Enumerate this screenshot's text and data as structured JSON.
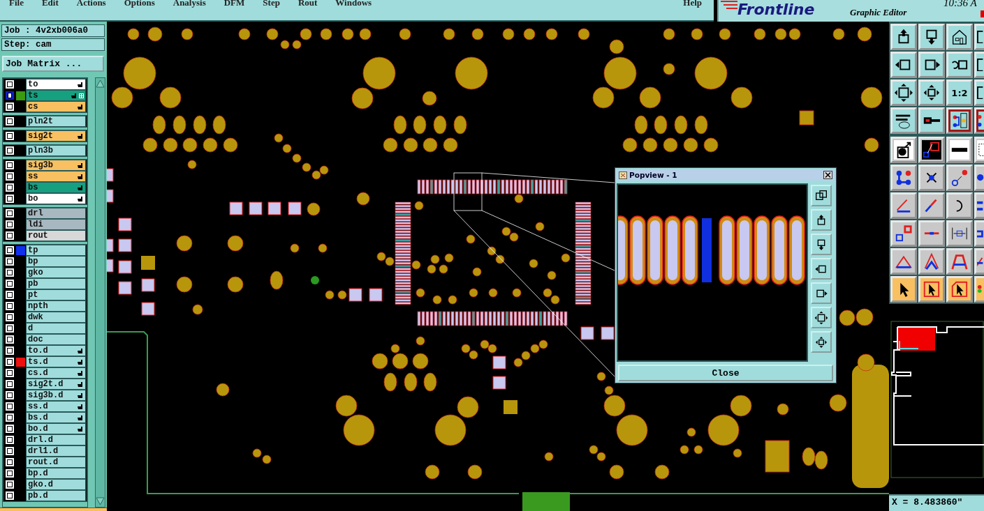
{
  "menu": [
    {
      "label": "File"
    },
    {
      "label": "Edit"
    },
    {
      "label": "Actions"
    },
    {
      "label": "Options"
    },
    {
      "label": "Analysis"
    },
    {
      "label": "DFM"
    },
    {
      "label": "Step"
    },
    {
      "label": "Rout"
    },
    {
      "label": "Windows"
    }
  ],
  "help_menu": "Help",
  "brand": {
    "logo": "Frontline",
    "subtitle": "Graphic Editor",
    "clock": "10:36 A"
  },
  "job": "Job : 4v2xb006a0",
  "step": "Step: cam",
  "job_matrix_button": "Job Matrix ...",
  "layer_groups": [
    {
      "layers": [
        {
          "name": "to",
          "kind": "silk",
          "selected": false,
          "affected": true,
          "flagged": false
        },
        {
          "name": "ts",
          "kind": "mask",
          "selected": true,
          "affected": true,
          "flagged": true,
          "color": "#3a9a10"
        },
        {
          "name": "cs",
          "kind": "signal",
          "selected": false,
          "affected": true,
          "flagged": false
        }
      ]
    },
    {
      "layers": [
        {
          "name": "pln2t",
          "kind": "power",
          "selected": false,
          "affected": false,
          "flagged": false
        }
      ]
    },
    {
      "layers": [
        {
          "name": "sig2t",
          "kind": "signal",
          "selected": false,
          "affected": true,
          "flagged": false
        }
      ]
    },
    {
      "layers": [
        {
          "name": "pln3b",
          "kind": "power",
          "selected": false,
          "affected": false,
          "flagged": false
        }
      ]
    },
    {
      "layers": [
        {
          "name": "sig3b",
          "kind": "signal",
          "selected": false,
          "affected": true,
          "flagged": false
        },
        {
          "name": "ss",
          "kind": "signal",
          "selected": false,
          "affected": true,
          "flagged": false
        },
        {
          "name": "bs",
          "kind": "mask",
          "selected": false,
          "affected": true,
          "flagged": false
        },
        {
          "name": "bo",
          "kind": "silk",
          "selected": false,
          "affected": true,
          "flagged": false
        }
      ]
    },
    {
      "layers": [
        {
          "name": "drl",
          "kind": "drill",
          "selected": false,
          "affected": false,
          "flagged": false
        },
        {
          "name": "ldi",
          "kind": "drill",
          "selected": false,
          "affected": false,
          "flagged": false
        },
        {
          "name": "rout",
          "kind": "rout",
          "selected": false,
          "affected": false,
          "flagged": false
        }
      ]
    },
    {
      "layers": [
        {
          "name": "tp",
          "kind": "document",
          "selected": false,
          "affected": false,
          "flagged": false,
          "color": "#1030f0"
        },
        {
          "name": "bp",
          "kind": "document",
          "selected": false,
          "affected": false,
          "flagged": false
        },
        {
          "name": "gko",
          "kind": "document",
          "selected": false,
          "affected": false,
          "flagged": false
        },
        {
          "name": "pb",
          "kind": "document",
          "selected": false,
          "affected": false,
          "flagged": false
        },
        {
          "name": "pt",
          "kind": "document",
          "selected": false,
          "affected": false,
          "flagged": false
        },
        {
          "name": "npth",
          "kind": "document",
          "selected": false,
          "affected": false,
          "flagged": false
        },
        {
          "name": "dwk",
          "kind": "document",
          "selected": false,
          "affected": false,
          "flagged": false
        },
        {
          "name": "d",
          "kind": "document",
          "selected": false,
          "affected": false,
          "flagged": false
        },
        {
          "name": "doc",
          "kind": "document",
          "selected": false,
          "affected": false,
          "flagged": false
        },
        {
          "name": "to.d",
          "kind": "document",
          "selected": false,
          "affected": true,
          "flagged": false
        },
        {
          "name": "ts.d",
          "kind": "document",
          "selected": false,
          "affected": true,
          "flagged": false,
          "color": "#f01010"
        },
        {
          "name": "cs.d",
          "kind": "document",
          "selected": false,
          "affected": true,
          "flagged": false
        },
        {
          "name": "sig2t.d",
          "kind": "document",
          "selected": false,
          "affected": true,
          "flagged": false
        },
        {
          "name": "sig3b.d",
          "kind": "document",
          "selected": false,
          "affected": true,
          "flagged": false
        },
        {
          "name": "ss.d",
          "kind": "document",
          "selected": false,
          "affected": true,
          "flagged": false
        },
        {
          "name": "bs.d",
          "kind": "document",
          "selected": false,
          "affected": true,
          "flagged": false
        },
        {
          "name": "bo.d",
          "kind": "document",
          "selected": false,
          "affected": true,
          "flagged": false
        },
        {
          "name": "drl.d",
          "kind": "document",
          "selected": false,
          "affected": false,
          "flagged": false
        },
        {
          "name": "drl1.d",
          "kind": "document",
          "selected": false,
          "affected": false,
          "flagged": false
        },
        {
          "name": "rout.d",
          "kind": "document",
          "selected": false,
          "affected": false,
          "flagged": false
        },
        {
          "name": "bp.d",
          "kind": "document",
          "selected": false,
          "affected": false,
          "flagged": false
        },
        {
          "name": "gko.d",
          "kind": "document",
          "selected": false,
          "affected": false,
          "flagged": false
        },
        {
          "name": "pb.d",
          "kind": "document",
          "selected": false,
          "affected": false,
          "flagged": false
        }
      ]
    }
  ],
  "popview": {
    "title": "Popview - 1",
    "close_button": "Close"
  },
  "toolbar": [
    {
      "kind": "view",
      "buttons": [
        {
          "selected": false
        },
        {
          "selected": false
        },
        {
          "selected": false
        },
        {
          "selected": false
        }
      ]
    },
    {
      "kind": "view",
      "buttons": [
        {
          "selected": false
        },
        {
          "selected": false
        },
        {
          "selected": false
        },
        {
          "selected": false
        }
      ]
    },
    {
      "kind": "view",
      "buttons": [
        {
          "selected": false
        },
        {
          "selected": false
        },
        {
          "selected": false,
          "label": "1:2"
        },
        {
          "selected": false
        }
      ]
    },
    {
      "kind": "view",
      "buttons": [
        {
          "selected": false
        },
        {
          "selected": false
        },
        {
          "selected": true
        },
        {
          "selected": true
        }
      ]
    },
    {
      "kind": "edit",
      "buttons": [
        {
          "selected": false
        },
        {
          "selected": false
        },
        {
          "selected": false
        },
        {
          "selected": false
        }
      ]
    },
    {
      "kind": "edit",
      "buttons": [
        {
          "selected": false
        },
        {
          "selected": false
        },
        {
          "selected": false
        },
        {
          "selected": false
        }
      ]
    },
    {
      "kind": "edit",
      "buttons": [
        {
          "selected": false
        },
        {
          "selected": false
        },
        {
          "selected": false
        },
        {
          "selected": false
        }
      ]
    },
    {
      "kind": "edit",
      "buttons": [
        {
          "selected": false
        },
        {
          "selected": false
        },
        {
          "selected": false
        },
        {
          "selected": false
        }
      ]
    },
    {
      "kind": "edit",
      "buttons": [
        {
          "selected": false
        },
        {
          "selected": false
        },
        {
          "selected": false
        },
        {
          "selected": false
        }
      ]
    },
    {
      "kind": "select",
      "buttons": [
        {
          "selected": false
        },
        {
          "selected": false
        },
        {
          "selected": false
        },
        {
          "selected": false
        }
      ]
    }
  ],
  "coordinates": {
    "x": "X = 8.483860\""
  }
}
